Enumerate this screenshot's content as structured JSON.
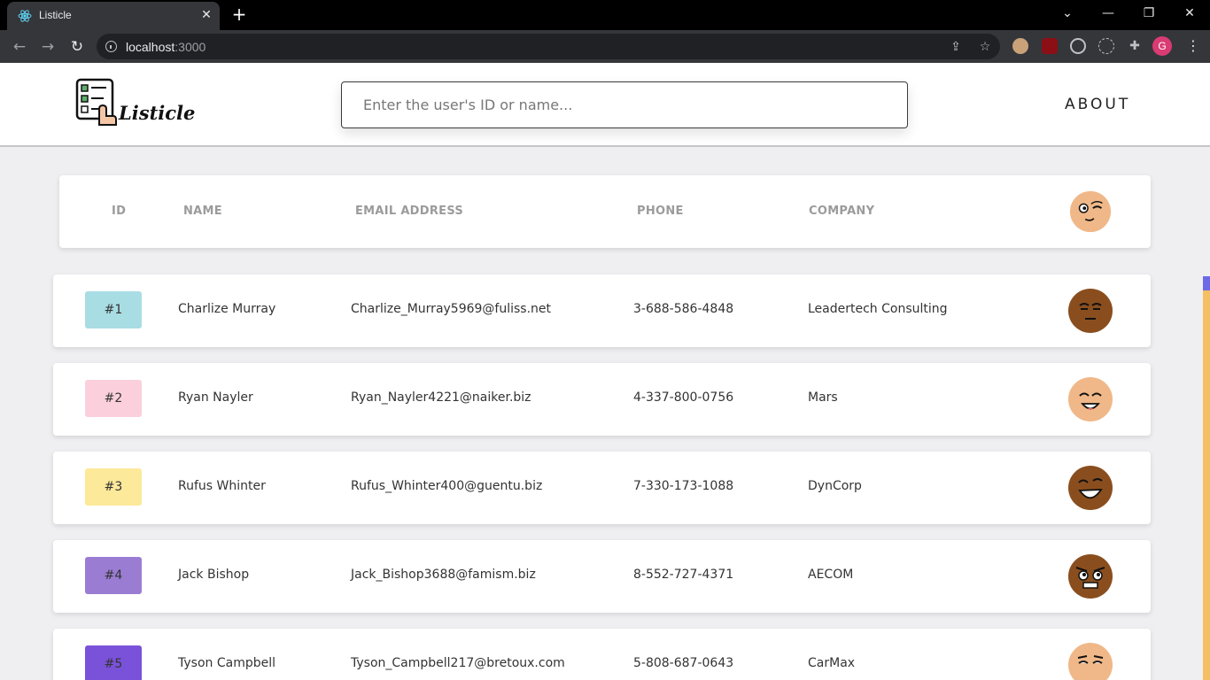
{
  "browser": {
    "tab_title": "Listicle",
    "url_host": "localhost",
    "url_port": ":3000",
    "profile_initial": "G"
  },
  "header": {
    "logo_text": "Listicle",
    "search_placeholder": "Enter the user's ID or name...",
    "about_label": "ABOUT"
  },
  "table": {
    "columns": [
      "ID",
      "NAME",
      "EMAIL ADDRESS",
      "PHONE",
      "COMPANY"
    ],
    "rows": [
      {
        "id": "#1",
        "name": "Charlize Murray",
        "email": "Charlize_Murray5969@fuliss.net",
        "phone": "3-688-586-4848",
        "company": "Leadertech Consulting",
        "badge_color": "#a9dde4",
        "avatar_skin": "#8a4e1e"
      },
      {
        "id": "#2",
        "name": "Ryan Nayler",
        "email": "Ryan_Nayler4221@naiker.biz",
        "phone": "4-337-800-0756",
        "company": "Mars",
        "badge_color": "#fbd0dc",
        "avatar_skin": "#f0b888"
      },
      {
        "id": "#3",
        "name": "Rufus Whinter",
        "email": "Rufus_Whinter400@guentu.biz",
        "phone": "7-330-173-1088",
        "company": "DynCorp",
        "badge_color": "#fde99a",
        "avatar_skin": "#8a4e1e"
      },
      {
        "id": "#4",
        "name": "Jack Bishop",
        "email": "Jack_Bishop3688@famism.biz",
        "phone": "8-552-727-4371",
        "company": "AECOM",
        "badge_color": "#9a7cd3",
        "avatar_skin": "#8a4e1e"
      },
      {
        "id": "#5",
        "name": "Tyson Campbell",
        "email": "Tyson_Campbell217@bretoux.com",
        "phone": "5-808-687-0643",
        "company": "CarMax",
        "badge_color": "#7a52d9",
        "avatar_skin": "#f0b888"
      }
    ]
  },
  "colors": {
    "accent_scroll": "#f4c062",
    "scroll_thumb": "#6d6ae8",
    "page_bg": "#efeff2"
  }
}
